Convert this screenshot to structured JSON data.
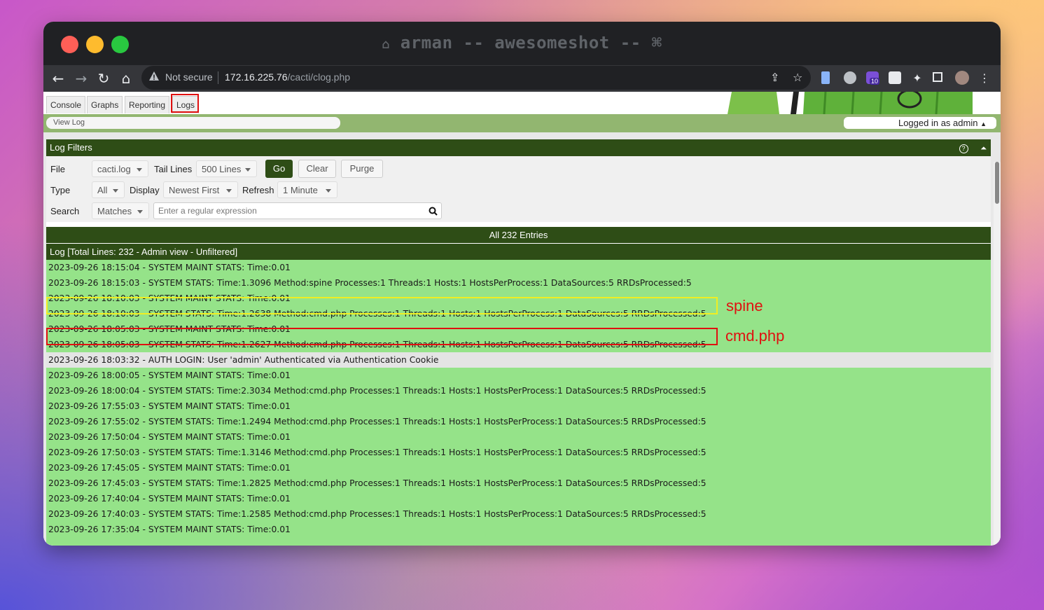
{
  "window": {
    "title": "arman -- awesomeshot --"
  },
  "browser": {
    "security_label": "Not secure",
    "url_host": "172.16.225.76",
    "url_path": "/cacti/clog.php",
    "extension_badge": "10"
  },
  "tabs": [
    "Console",
    "Graphs",
    "Reporting",
    "Logs"
  ],
  "breadcrumb": "View Log",
  "user_status": "Logged in as admin",
  "filters": {
    "title": "Log Filters",
    "file_label": "File",
    "file_value": "cacti.log",
    "tail_label": "Tail Lines",
    "tail_value": "500 Lines",
    "go": "Go",
    "clear": "Clear",
    "purge": "Purge",
    "type_label": "Type",
    "type_value": "All",
    "display_label": "Display",
    "display_value": "Newest First",
    "refresh_label": "Refresh",
    "refresh_value": "1 Minute",
    "search_label": "Search",
    "search_mode": "Matches",
    "search_placeholder": "Enter a regular expression"
  },
  "entries_summary": "All 232 Entries",
  "log_header": "Log [Total Lines: 232 - Admin view - Unfiltered]",
  "log_lines": [
    "2023-09-26 18:15:04 - SYSTEM MAINT STATS: Time:0.01",
    "2023-09-26 18:15:03 - SYSTEM STATS: Time:1.3096 Method:spine Processes:1 Threads:1 Hosts:1 HostsPerProcess:1 DataSources:5 RRDsProcessed:5",
    "2023-09-26 18:10:03 - SYSTEM MAINT STATS: Time:0.01",
    "2023-09-26 18:10:03 - SYSTEM STATS: Time:1.2638 Method:cmd.php Processes:1 Threads:1 Hosts:1 HostsPerProcess:1 DataSources:5 RRDsProcessed:5",
    "2023-09-26 18:05:03 - SYSTEM MAINT STATS: Time:0.01",
    "2023-09-26 18:05:03 - SYSTEM STATS: Time:1.2627 Method:cmd.php Processes:1 Threads:1 Hosts:1 HostsPerProcess:1 DataSources:5 RRDsProcessed:5",
    "2023-09-26 18:03:32 - AUTH LOGIN: User 'admin' Authenticated via Authentication Cookie",
    "2023-09-26 18:00:05 - SYSTEM MAINT STATS: Time:0.01",
    "2023-09-26 18:00:04 - SYSTEM STATS: Time:2.3034 Method:cmd.php Processes:1 Threads:1 Hosts:1 HostsPerProcess:1 DataSources:5 RRDsProcessed:5",
    "2023-09-26 17:55:03 - SYSTEM MAINT STATS: Time:0.01",
    "2023-09-26 17:55:02 - SYSTEM STATS: Time:1.2494 Method:cmd.php Processes:1 Threads:1 Hosts:1 HostsPerProcess:1 DataSources:5 RRDsProcessed:5",
    "2023-09-26 17:50:04 - SYSTEM MAINT STATS: Time:0.01",
    "2023-09-26 17:50:03 - SYSTEM STATS: Time:1.3146 Method:cmd.php Processes:1 Threads:1 Hosts:1 HostsPerProcess:1 DataSources:5 RRDsProcessed:5",
    "2023-09-26 17:45:05 - SYSTEM MAINT STATS: Time:0.01",
    "2023-09-26 17:45:03 - SYSTEM STATS: Time:1.2825 Method:cmd.php Processes:1 Threads:1 Hosts:1 HostsPerProcess:1 DataSources:5 RRDsProcessed:5",
    "2023-09-26 17:40:04 - SYSTEM MAINT STATS: Time:0.01",
    "2023-09-26 17:40:03 - SYSTEM STATS: Time:1.2585 Method:cmd.php Processes:1 Threads:1 Hosts:1 HostsPerProcess:1 DataSources:5 RRDsProcessed:5",
    "2023-09-26 17:35:04 - SYSTEM MAINT STATS: Time:0.01"
  ],
  "annotations": {
    "spine": "spine",
    "cmd": "cmd.php"
  },
  "colors": {
    "log_row": "#95e389",
    "header_dark": "#2e4d16",
    "highlight_yellow": "#f0ee22",
    "highlight_red": "#e01010"
  }
}
